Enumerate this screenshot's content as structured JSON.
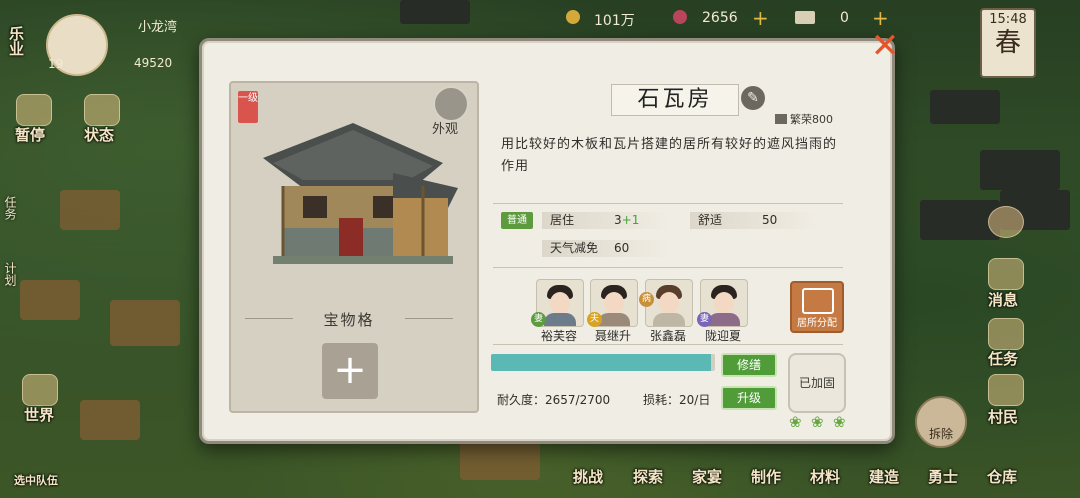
{
  "hud": {
    "player_name": "小龙湾",
    "level": "19",
    "prosperity_value": "49520",
    "currency1": "101万",
    "currency2": "2656",
    "currency3": "0",
    "time": "15:48",
    "season": "春"
  },
  "left_menu": {
    "top_tab": "乐业",
    "items": [
      "暂停",
      "状态",
      "世界",
      "选中队伍"
    ],
    "vertical": [
      "任务",
      "计划"
    ]
  },
  "right_menu": [
    "消息",
    "任务",
    "村民"
  ],
  "bottom_menu": [
    "挑战",
    "探索",
    "家宴",
    "制作",
    "材料",
    "建造",
    "勇士",
    "仓库"
  ],
  "demolish_label": "拆除",
  "panel": {
    "grade": "一级",
    "appearance_label": "外观",
    "treasure_label": "宝物格",
    "add_symbol": "+",
    "close_symbol": "✕",
    "building_name": "石瓦房",
    "prosperity_label": "繁荣800",
    "description": "用比较好的木板和瓦片搭建的居所有较好的遮风挡雨的作用",
    "quality": "普通",
    "stats": {
      "live_label": "居住",
      "live_value": "3",
      "live_bonus": "+1",
      "comfort_label": "舒适",
      "comfort_value": "50",
      "weather_label": "天气减免",
      "weather_value": "60"
    },
    "residents": [
      {
        "name": "裕芙容",
        "tag": "妻",
        "tag_color": "#5d9b3f"
      },
      {
        "name": "聂继升",
        "tag": "夫",
        "tag_color": "#d8a320"
      },
      {
        "name": "张鑫磊",
        "tag": "病",
        "tag_color": "#c8903a"
      },
      {
        "name": "陇迎夏",
        "tag": "妻",
        "tag_color": "#7a66b8"
      }
    ],
    "assign_label": "居所分配",
    "durability_label": "耐久度：2657/2700",
    "durability_fraction": 0.984,
    "consumption_label": "损耗：20/日",
    "repair_label": "修缮",
    "upgrade_label": "升级",
    "fixed_label": "已加固"
  },
  "colors": {
    "panel_bg": "#f0ede4",
    "accent_green": "#4f9c39",
    "bar_teal": "#5ab8b5",
    "close_orange": "#e8542a"
  }
}
